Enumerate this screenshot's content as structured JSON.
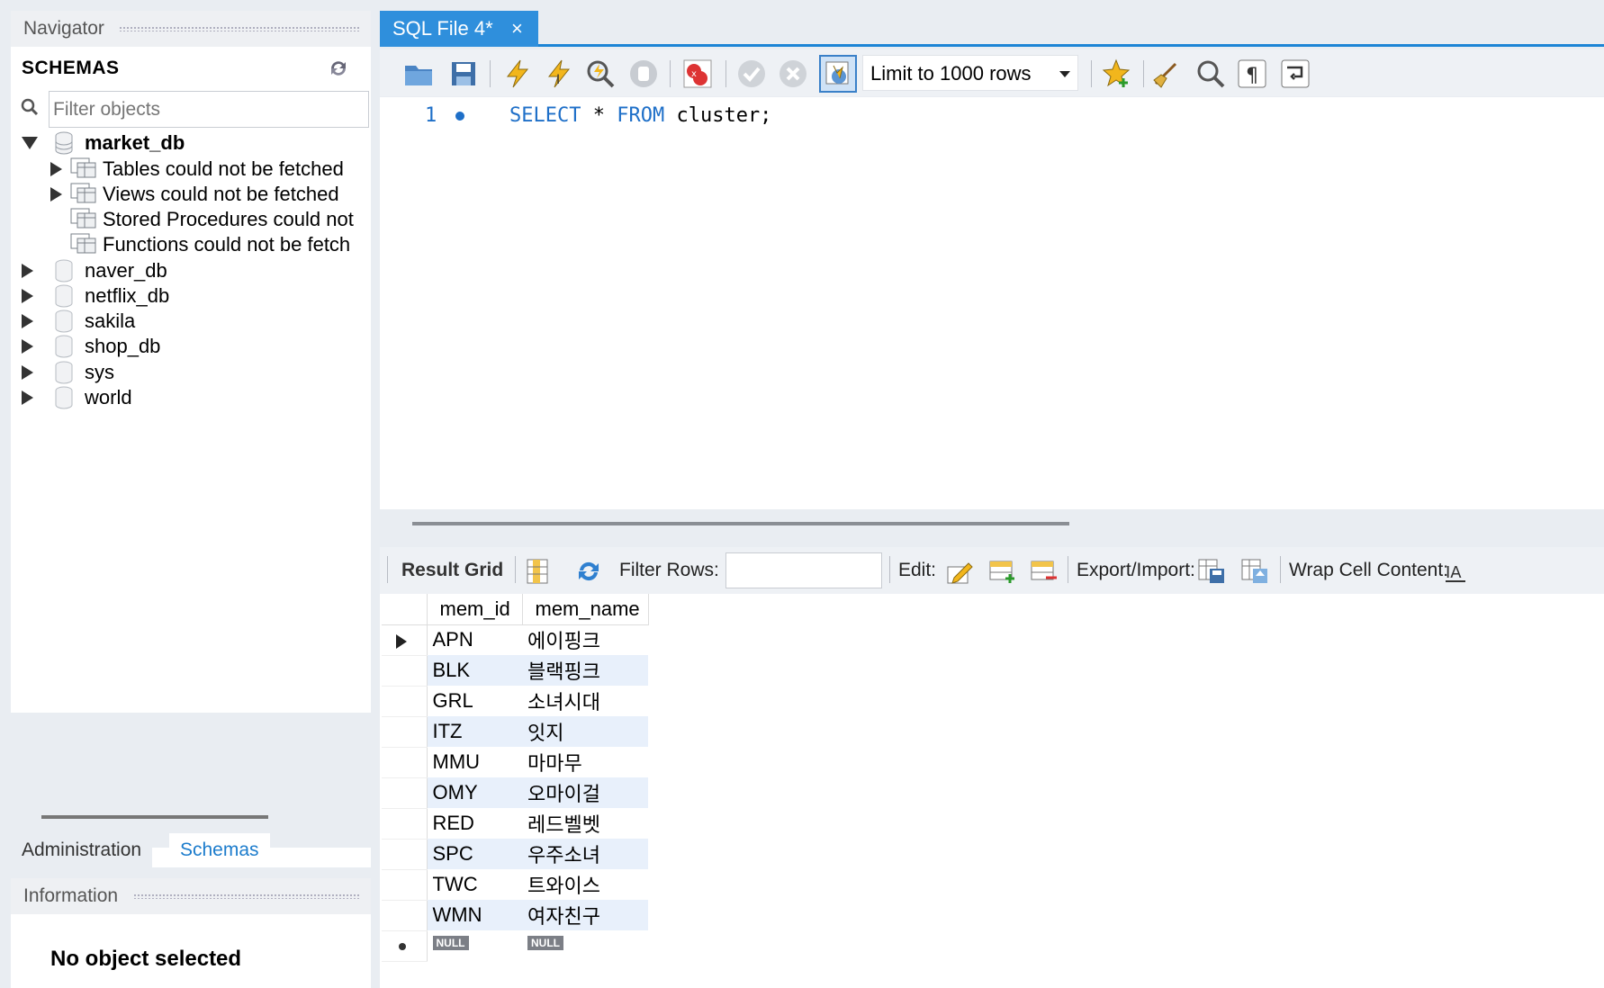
{
  "navigator": {
    "title": "Navigator",
    "schemas_header": "SCHEMAS",
    "filter_placeholder": "Filter objects",
    "tree": {
      "open_db": "market_db",
      "children": [
        "Tables could not be fetched",
        "Views could not be fetched",
        "Stored Procedures could not",
        "Functions could not be fetch"
      ],
      "dbs": [
        "naver_db",
        "netflix_db",
        "sakila",
        "shop_db",
        "sys",
        "world"
      ]
    },
    "tabs": {
      "administration": "Administration",
      "schemas": "Schemas"
    },
    "info_title": "Information",
    "info_text": "No object selected"
  },
  "editor": {
    "tab_label": "SQL File 4*",
    "limit_label": "Limit to 1000 rows",
    "line_number": "1",
    "code": {
      "kw1": "SELECT",
      "star": "*",
      "kw2": "FROM",
      "rest": "cluster;"
    }
  },
  "result_toolbar": {
    "result_grid": "Result Grid",
    "filter_rows": "Filter Rows:",
    "edit": "Edit:",
    "export_import": "Export/Import:",
    "wrap_cell": "Wrap Cell Content:"
  },
  "grid": {
    "columns": [
      "mem_id",
      "mem_name"
    ],
    "rows": [
      [
        "APN",
        "에이핑크"
      ],
      [
        "BLK",
        "블랙핑크"
      ],
      [
        "GRL",
        "소녀시대"
      ],
      [
        "ITZ",
        "잇지"
      ],
      [
        "MMU",
        "마마무"
      ],
      [
        "OMY",
        "오마이걸"
      ],
      [
        "RED",
        "레드벨벳"
      ],
      [
        "SPC",
        "우주소녀"
      ],
      [
        "TWC",
        "트와이스"
      ],
      [
        "WMN",
        "여자친구"
      ]
    ],
    "null_label": "NULL"
  },
  "colors": {
    "accent": "#2f8fdc",
    "keyword": "#1e6fc8",
    "alt_row": "#e8f0fb"
  }
}
